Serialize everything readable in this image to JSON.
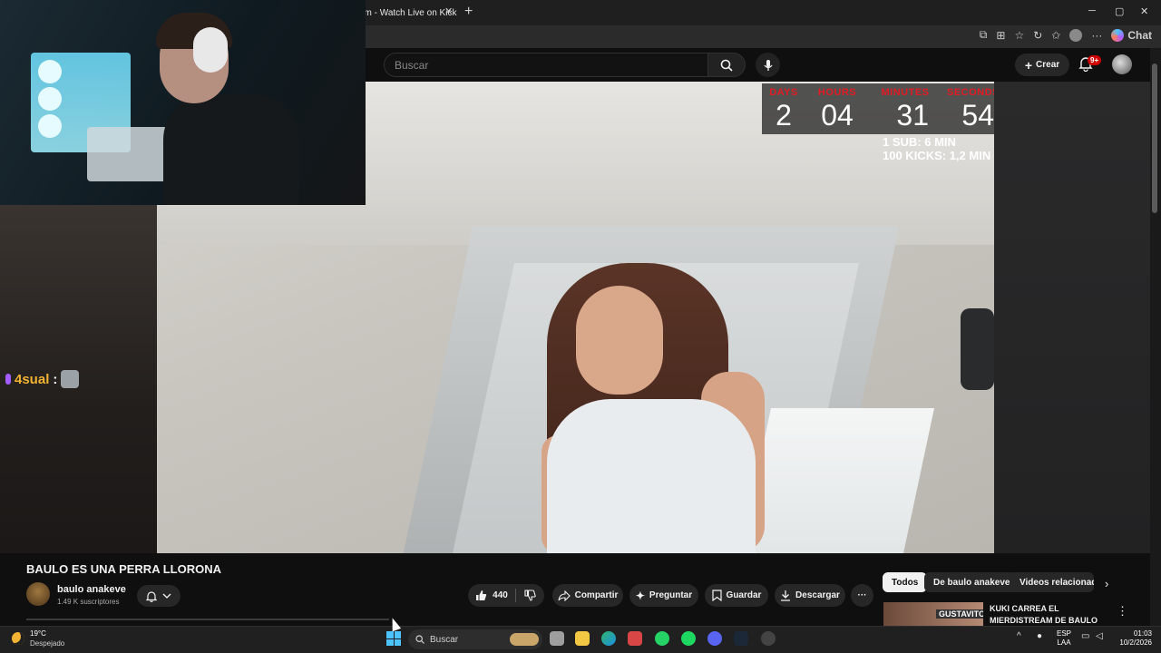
{
  "browser": {
    "tab_title": "am - Watch Live on Kick",
    "tab_close": "✕",
    "new_tab": "+",
    "window_controls": [
      "─",
      "▢",
      "✕"
    ],
    "chat_label": "Chat",
    "toolbar_more": "···"
  },
  "header": {
    "search_placeholder": "Buscar",
    "create_label": "Crear",
    "notification_badge": "9+"
  },
  "overlay": {
    "countdown": [
      {
        "label": "DAYS",
        "value": "2"
      },
      {
        "label": "HOURS",
        "value": "04"
      },
      {
        "label": "MINUTES",
        "value": "31"
      },
      {
        "label": "SECONDS",
        "value": "54"
      }
    ],
    "sub_rate": "1 SUB: 6 MIN",
    "kicks_rate": "100 KICKS: 1,2 MIN",
    "label_color": "#e31b23"
  },
  "chat": {
    "user": "4sual",
    "separator": ":"
  },
  "video": {
    "title": "BAULO ES UNA PERRA LLORONA",
    "channel_name": "baulo anakeve",
    "subscribers": "1.49 K suscriptores",
    "likes": "440",
    "actions": {
      "share": "Compartir",
      "ask": "Preguntar",
      "save": "Guardar",
      "download": "Descargar",
      "more": "···"
    }
  },
  "related": {
    "chips": [
      "Todos",
      "De baulo anakeve",
      "Videos relacionados"
    ],
    "next_chevron": "›",
    "first_title": "KUKI CARREA EL MIERDISTREAM DE BAULO",
    "first_thumb_text": "GUSTAVITO",
    "more": "⋮"
  },
  "taskbar": {
    "temperature": "19°C",
    "weather": "Despejado",
    "search_label": "Buscar",
    "lang_line1": "ESP",
    "lang_line2": "LAA",
    "time": "01:03",
    "date": "10/2/2026",
    "tray_chevron": "^",
    "accent": "#4cc2ff"
  }
}
